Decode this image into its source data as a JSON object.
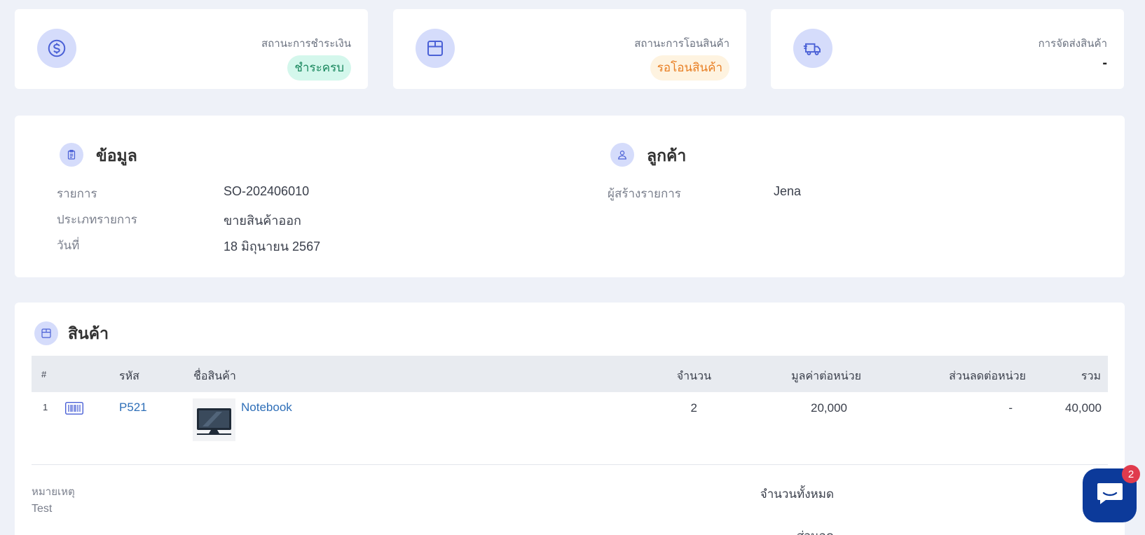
{
  "status_cards": {
    "payment": {
      "label": "สถานะการชำระเงิน",
      "badge": "ชำระครบ",
      "icon": "dollar-circle-icon"
    },
    "transfer": {
      "label": "สถานะการโอนสินค้า",
      "badge": "รอโอนสินค้า",
      "icon": "box-icon"
    },
    "shipping": {
      "label": "การจัดส่งสินค้า",
      "value": "-",
      "icon": "delivery-truck-icon"
    }
  },
  "info": {
    "title": "ข้อมูล",
    "fields": [
      {
        "label": "รายการ",
        "value": "SO-202406010"
      },
      {
        "label": "ประเภทรายการ",
        "value": "ขายสินค้าออก"
      },
      {
        "label": "วันที่",
        "value": "18 มิถุนายน 2567"
      }
    ]
  },
  "customer": {
    "title": "ลูกค้า",
    "fields": [
      {
        "label": "ผู้สร้างรายการ",
        "value": "Jena"
      }
    ]
  },
  "products": {
    "title": "สินค้า",
    "headers": {
      "index": "#",
      "code": "รหัส",
      "name": "ชื่อสินค้า",
      "qty": "จำนวน",
      "unit_price": "มูลค่าต่อหน่วย",
      "discount": "ส่วนลดต่อหน่วย",
      "total": "รวม"
    },
    "rows": [
      {
        "index": "1",
        "code": "P521",
        "name": "Notebook",
        "qty": "2",
        "unit_price": "20,000",
        "discount": "-",
        "total": "40,000"
      }
    ]
  },
  "footer": {
    "note_label": "หมายเหตุ",
    "note_value": "Test",
    "total_qty_label": "จำนวนทั้งหมด",
    "discount_label": "ส่วนลด"
  },
  "chat": {
    "badge_count": "2"
  },
  "colors": {
    "background": "#eef1f8",
    "icon_circle": "#d5dcfb",
    "badge_green_bg": "#d4f7ec",
    "badge_green_text": "#19875d",
    "badge_orange_bg": "#fef3e0",
    "badge_orange_text": "#e87e22",
    "link": "#2f6fb8",
    "chat_button": "#0c3a9a"
  }
}
